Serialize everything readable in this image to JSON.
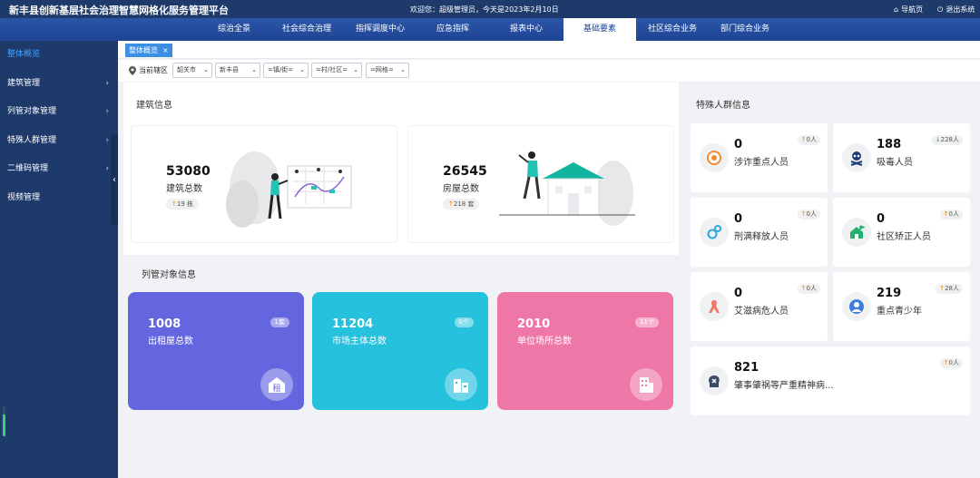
{
  "header": {
    "title": "新丰县创新基层社会治理智慧网格化服务管理平台",
    "welcome": "欢迎您：超级管理员，今天是2023年2月10日",
    "home_link": "导航页",
    "logout_link": "退出系统"
  },
  "nav": {
    "items": [
      "综治全景",
      "社会综合治理",
      "指挥调度中心",
      "应急指挥",
      "报表中心",
      "基础要素",
      "社区综合业务",
      "部门综合业务"
    ],
    "active_index": 5
  },
  "sidebar": {
    "items": [
      {
        "label": "整体概览"
      },
      {
        "label": "建筑管理"
      },
      {
        "label": "列管对象管理"
      },
      {
        "label": "特殊人群管理"
      },
      {
        "label": "二维码管理"
      },
      {
        "label": "视频管理"
      }
    ],
    "active_index": 0,
    "indicator_level": 0.7
  },
  "tabs": [
    {
      "label": "整体概览",
      "close": "×"
    }
  ],
  "filters": {
    "label": "当前辖区",
    "selects": [
      "韶关市",
      "新丰县",
      "=镇/街=",
      "=村/社区=",
      "=网格="
    ]
  },
  "building_section": {
    "title": "建筑信息",
    "cards": [
      {
        "value": "53080",
        "label": "建筑总数",
        "badge": "19 栋"
      },
      {
        "value": "26545",
        "label": "房屋总数",
        "badge": "218 套"
      }
    ]
  },
  "managed_section": {
    "title": "列管对象信息",
    "cards": [
      {
        "value": "1008",
        "label": "出租屋总数",
        "badge": "1套",
        "color": "#6466e0",
        "icon_char": "租"
      },
      {
        "value": "11204",
        "label": "市场主体总数",
        "badge": "0个",
        "color": "#26c1dd",
        "icon_char": ""
      },
      {
        "value": "2010",
        "label": "单位场所总数",
        "badge": "11个",
        "color": "#ef77a8",
        "icon_char": ""
      }
    ]
  },
  "special_section": {
    "title": "特殊人群信息",
    "cards": [
      {
        "value": "0",
        "label": "涉诈重点人员",
        "badge": "0人",
        "icon": "phone-signal-icon",
        "badge_dir": "up"
      },
      {
        "value": "188",
        "label": "吸毒人员",
        "badge": "228人",
        "icon": "skull-icon",
        "badge_dir": "down"
      },
      {
        "value": "0",
        "label": "刑满释放人员",
        "badge": "0人",
        "icon": "handcuffs-icon",
        "badge_dir": "up"
      },
      {
        "value": "0",
        "label": "社区矫正人员",
        "badge": "0人",
        "icon": "house-flag-icon",
        "badge_dir": "up"
      },
      {
        "value": "0",
        "label": "艾滋病危人员",
        "badge": "0人",
        "icon": "ribbon-icon",
        "badge_dir": "up"
      },
      {
        "value": "219",
        "label": "重点青少年",
        "badge": "28人",
        "icon": "person-icon",
        "badge_dir": "up"
      },
      {
        "value": "821",
        "label": "肇事肇祸等严重精神病...",
        "badge": "0人",
        "icon": "head-icon",
        "badge_dir": "up"
      }
    ]
  },
  "colors": {
    "accent": "#3a8ee6",
    "sidebar": "#1d3a6b",
    "up": "#f28a00",
    "down": "#22b45c"
  }
}
